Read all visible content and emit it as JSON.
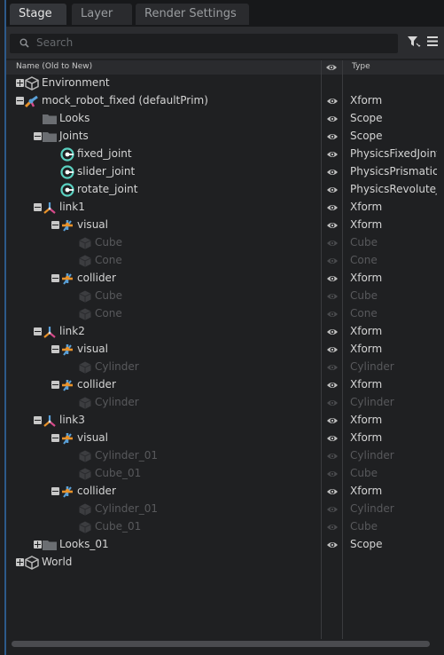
{
  "tabs": [
    {
      "label": "Stage",
      "active": true
    },
    {
      "label": "Layer",
      "active": false
    },
    {
      "label": "Render Settings",
      "active": false
    }
  ],
  "search": {
    "placeholder": "Search"
  },
  "columns": {
    "name": "Name (Old to New)",
    "type": "Type"
  },
  "colors": {
    "accent": "#2d5a8a",
    "joint": "#5bd1c1",
    "xform_orange": "#e8922a",
    "xform_blue": "#5aa0d8"
  },
  "tree": [
    {
      "label": "Environment",
      "type": "",
      "icon": "environment-cube-icon",
      "depth": 0,
      "expander": "plus",
      "dim": false,
      "eye": false
    },
    {
      "label": "mock_robot_fixed (defaultPrim)",
      "type": "Xform",
      "icon": "robot-xform-icon",
      "depth": 0,
      "expander": "minus",
      "dim": false,
      "eye": true
    },
    {
      "label": "Looks",
      "type": "Scope",
      "icon": "folder-icon",
      "depth": 1,
      "expander": "",
      "dim": false,
      "eye": true
    },
    {
      "label": "Joints",
      "type": "Scope",
      "icon": "folder-icon",
      "depth": 1,
      "expander": "minus",
      "dim": false,
      "eye": true
    },
    {
      "label": "fixed_joint",
      "type": "PhysicsFixedJoint",
      "icon": "joint-icon",
      "depth": 2,
      "expander": "",
      "dim": false,
      "eye": true
    },
    {
      "label": "slider_joint",
      "type": "PhysicsPrismaticJoint",
      "icon": "joint-icon",
      "depth": 2,
      "expander": "",
      "dim": false,
      "eye": true
    },
    {
      "label": "rotate_joint",
      "type": "PhysicsRevoluteJoint",
      "icon": "joint-icon",
      "depth": 2,
      "expander": "",
      "dim": false,
      "eye": true
    },
    {
      "label": "link1",
      "type": "Xform",
      "icon": "axis-xform-icon",
      "depth": 1,
      "expander": "minus",
      "dim": false,
      "eye": true
    },
    {
      "label": "visual",
      "type": "Xform",
      "icon": "xform-icon",
      "depth": 2,
      "expander": "minus",
      "dim": false,
      "eye": true
    },
    {
      "label": "Cube",
      "type": "Cube",
      "icon": "mesh-cube-icon",
      "depth": 3,
      "expander": "",
      "dim": true,
      "eye": true
    },
    {
      "label": "Cone",
      "type": "Cone",
      "icon": "mesh-cube-icon",
      "depth": 3,
      "expander": "",
      "dim": true,
      "eye": true
    },
    {
      "label": "collider",
      "type": "Xform",
      "icon": "xform-icon",
      "depth": 2,
      "expander": "minus",
      "dim": false,
      "eye": true
    },
    {
      "label": "Cube",
      "type": "Cube",
      "icon": "mesh-cube-icon",
      "depth": 3,
      "expander": "",
      "dim": true,
      "eye": true
    },
    {
      "label": "Cone",
      "type": "Cone",
      "icon": "mesh-cube-icon",
      "depth": 3,
      "expander": "",
      "dim": true,
      "eye": true
    },
    {
      "label": "link2",
      "type": "Xform",
      "icon": "axis-xform-icon",
      "depth": 1,
      "expander": "minus",
      "dim": false,
      "eye": true
    },
    {
      "label": "visual",
      "type": "Xform",
      "icon": "xform-icon",
      "depth": 2,
      "expander": "minus",
      "dim": false,
      "eye": true
    },
    {
      "label": "Cylinder",
      "type": "Cylinder",
      "icon": "mesh-cube-icon",
      "depth": 3,
      "expander": "",
      "dim": true,
      "eye": true
    },
    {
      "label": "collider",
      "type": "Xform",
      "icon": "xform-icon",
      "depth": 2,
      "expander": "minus",
      "dim": false,
      "eye": true
    },
    {
      "label": "Cylinder",
      "type": "Cylinder",
      "icon": "mesh-cube-icon",
      "depth": 3,
      "expander": "",
      "dim": true,
      "eye": true
    },
    {
      "label": "link3",
      "type": "Xform",
      "icon": "axis-xform-icon",
      "depth": 1,
      "expander": "minus",
      "dim": false,
      "eye": true
    },
    {
      "label": "visual",
      "type": "Xform",
      "icon": "xform-icon",
      "depth": 2,
      "expander": "minus",
      "dim": false,
      "eye": true
    },
    {
      "label": "Cylinder_01",
      "type": "Cylinder",
      "icon": "mesh-cube-icon",
      "depth": 3,
      "expander": "",
      "dim": true,
      "eye": true
    },
    {
      "label": "Cube_01",
      "type": "Cube",
      "icon": "mesh-cube-icon",
      "depth": 3,
      "expander": "",
      "dim": true,
      "eye": true
    },
    {
      "label": "collider",
      "type": "Xform",
      "icon": "xform-icon",
      "depth": 2,
      "expander": "minus",
      "dim": false,
      "eye": true
    },
    {
      "label": "Cylinder_01",
      "type": "Cylinder",
      "icon": "mesh-cube-icon",
      "depth": 3,
      "expander": "",
      "dim": true,
      "eye": true
    },
    {
      "label": "Cube_01",
      "type": "Cube",
      "icon": "mesh-cube-icon",
      "depth": 3,
      "expander": "",
      "dim": true,
      "eye": true
    },
    {
      "label": "Looks_01",
      "type": "Scope",
      "icon": "folder-icon",
      "depth": 1,
      "expander": "plus",
      "dim": false,
      "eye": true
    },
    {
      "label": "World",
      "type": "",
      "icon": "world-cube-icon",
      "depth": 0,
      "expander": "plus",
      "dim": false,
      "eye": false
    }
  ]
}
